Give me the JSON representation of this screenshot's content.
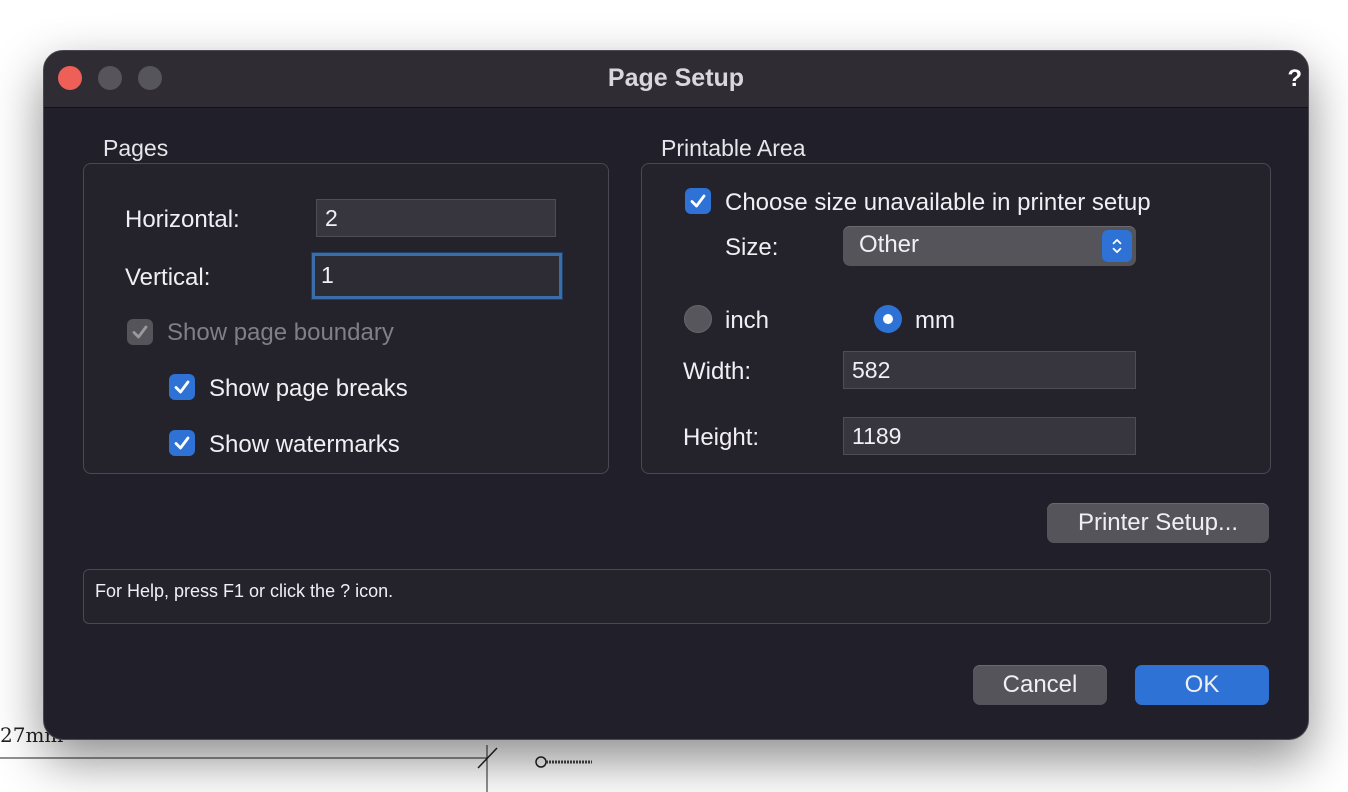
{
  "background": {
    "text_fragment": "27mm"
  },
  "dialog": {
    "title": "Page Setup",
    "help_glyph": "?",
    "pages": {
      "label": "Pages",
      "horizontal_label": "Horizontal:",
      "horizontal_value": "2",
      "vertical_label": "Vertical:",
      "vertical_value": "1",
      "show_page_boundary": {
        "label": "Show page boundary",
        "checked": true,
        "enabled": false
      },
      "show_page_breaks": {
        "label": "Show page breaks",
        "checked": true
      },
      "show_watermarks": {
        "label": "Show watermarks",
        "checked": true
      }
    },
    "printable_area": {
      "label": "Printable Area",
      "choose_size": {
        "label": "Choose size unavailable in printer setup",
        "checked": true
      },
      "size_label": "Size:",
      "size_value": "Other",
      "unit_inch": "inch",
      "unit_mm": "mm",
      "selected_unit": "mm",
      "width_label": "Width:",
      "width_value": "582",
      "height_label": "Height:",
      "height_value": "1189"
    },
    "printer_setup_label": "Printer Setup...",
    "help_text": "For Help, press F1 or click the ? icon.",
    "cancel_label": "Cancel",
    "ok_label": "OK"
  },
  "colors": {
    "accent": "#2e72d6",
    "dialog_bg": "#211f2a",
    "close": "#ed5f57"
  }
}
